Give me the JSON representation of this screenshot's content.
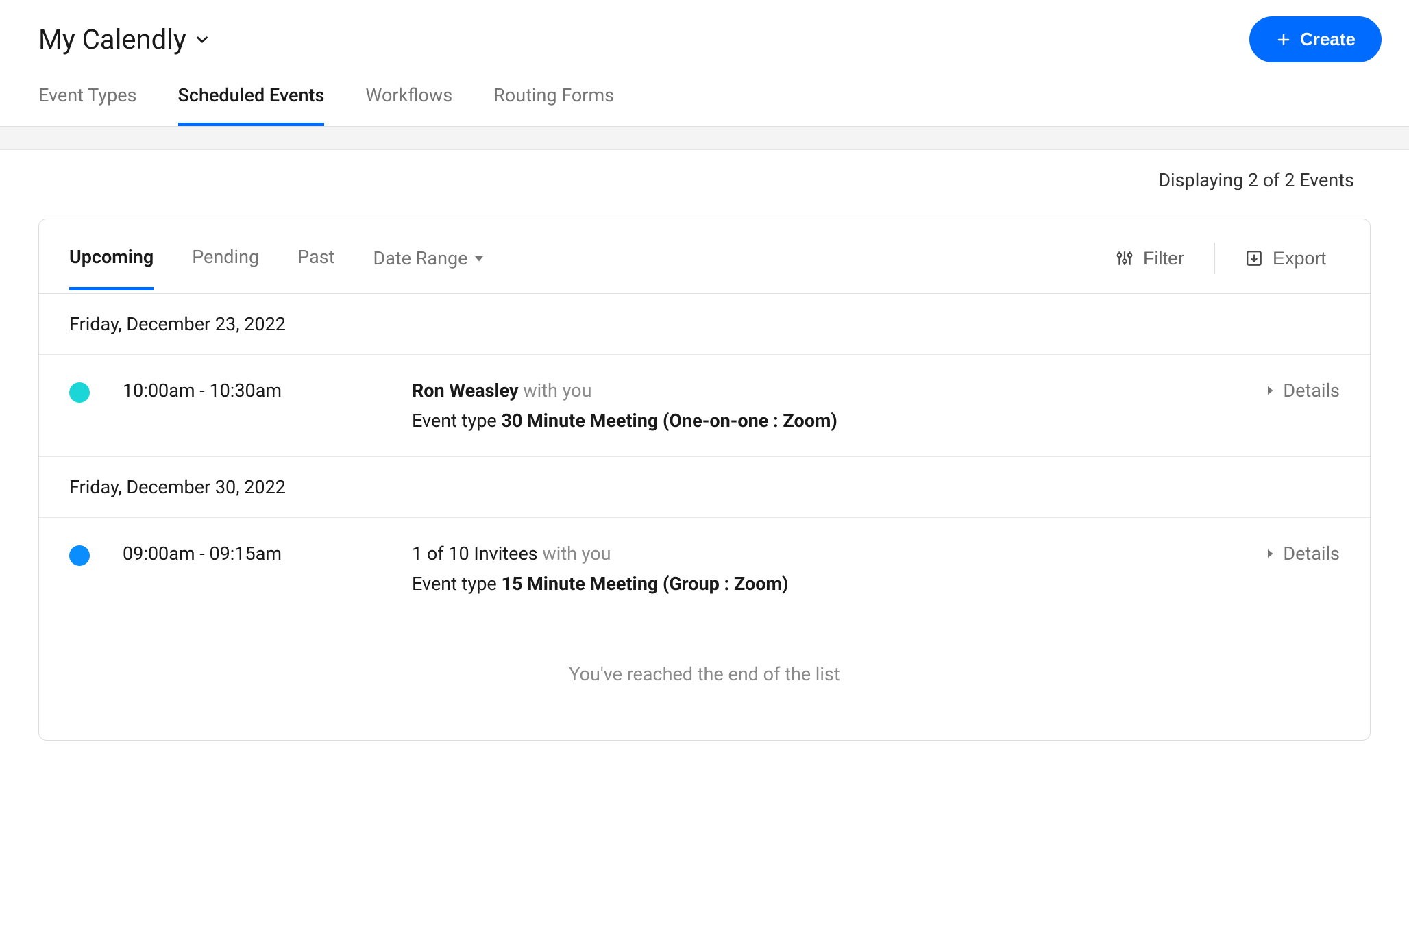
{
  "header": {
    "title": "My Calendly",
    "create_label": "Create"
  },
  "nav": {
    "tabs": [
      {
        "label": "Event Types",
        "active": false
      },
      {
        "label": "Scheduled Events",
        "active": true
      },
      {
        "label": "Workflows",
        "active": false
      },
      {
        "label": "Routing Forms",
        "active": false
      }
    ]
  },
  "count_text": "Displaying 2 of 2 Events",
  "sub_tabs": {
    "items": [
      {
        "label": "Upcoming",
        "active": true
      },
      {
        "label": "Pending",
        "active": false
      },
      {
        "label": "Past",
        "active": false
      }
    ],
    "date_range_label": "Date Range",
    "filter_label": "Filter",
    "export_label": "Export"
  },
  "groups": [
    {
      "date": "Friday, December 23, 2022",
      "events": [
        {
          "dot_color": "#1bd6d6",
          "time": "10:00am - 10:30am",
          "invitee": "Ron Weasley",
          "with_text": " with you",
          "event_type_prefix": "Event type ",
          "event_type": "30 Minute Meeting (One-on-one : Zoom)",
          "details_label": "Details"
        }
      ]
    },
    {
      "date": "Friday, December 30, 2022",
      "events": [
        {
          "dot_color": "#0a8dff",
          "time": "09:00am - 09:15am",
          "invitee": "1 of 10 Invitees",
          "with_text": " with you",
          "event_type_prefix": "Event type ",
          "event_type": "15 Minute Meeting (Group : Zoom)",
          "details_label": "Details"
        }
      ]
    }
  ],
  "end_message": "You've reached the end of the list"
}
